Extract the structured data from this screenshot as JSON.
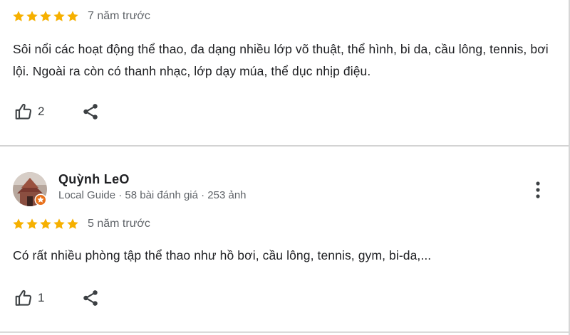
{
  "reviews": [
    {
      "stars": 5,
      "date": "7 năm trước",
      "text": "Sôi nổi các hoạt động thể thao, đa dạng nhiều lớp võ thuật, thể hình, bi da, cầu lông, tennis, bơi lội. Ngoài ra còn có thanh nhạc, lớp dạy múa, thể dục nhịp điệu.",
      "likes": "2"
    },
    {
      "reviewer_name": "Quỳnh LeO",
      "reviewer_meta": "Local Guide · 58 bài đánh giá · 253 ảnh",
      "stars": 5,
      "date": "5 năm trước",
      "text": "Có rất nhiều phòng tập thể thao như hồ bơi, cầu lông, tennis, gym, bi-da,...",
      "likes": "1"
    }
  ],
  "icons": {
    "star": "star-icon",
    "like": "thumbs-up-icon",
    "share": "share-icon",
    "more": "more-vertical-icon",
    "badge": "local-guide-badge-icon"
  },
  "colors": {
    "star": "#f6b000",
    "text": "#202124",
    "secondary": "#5f6368",
    "badge": "#e8711c"
  }
}
